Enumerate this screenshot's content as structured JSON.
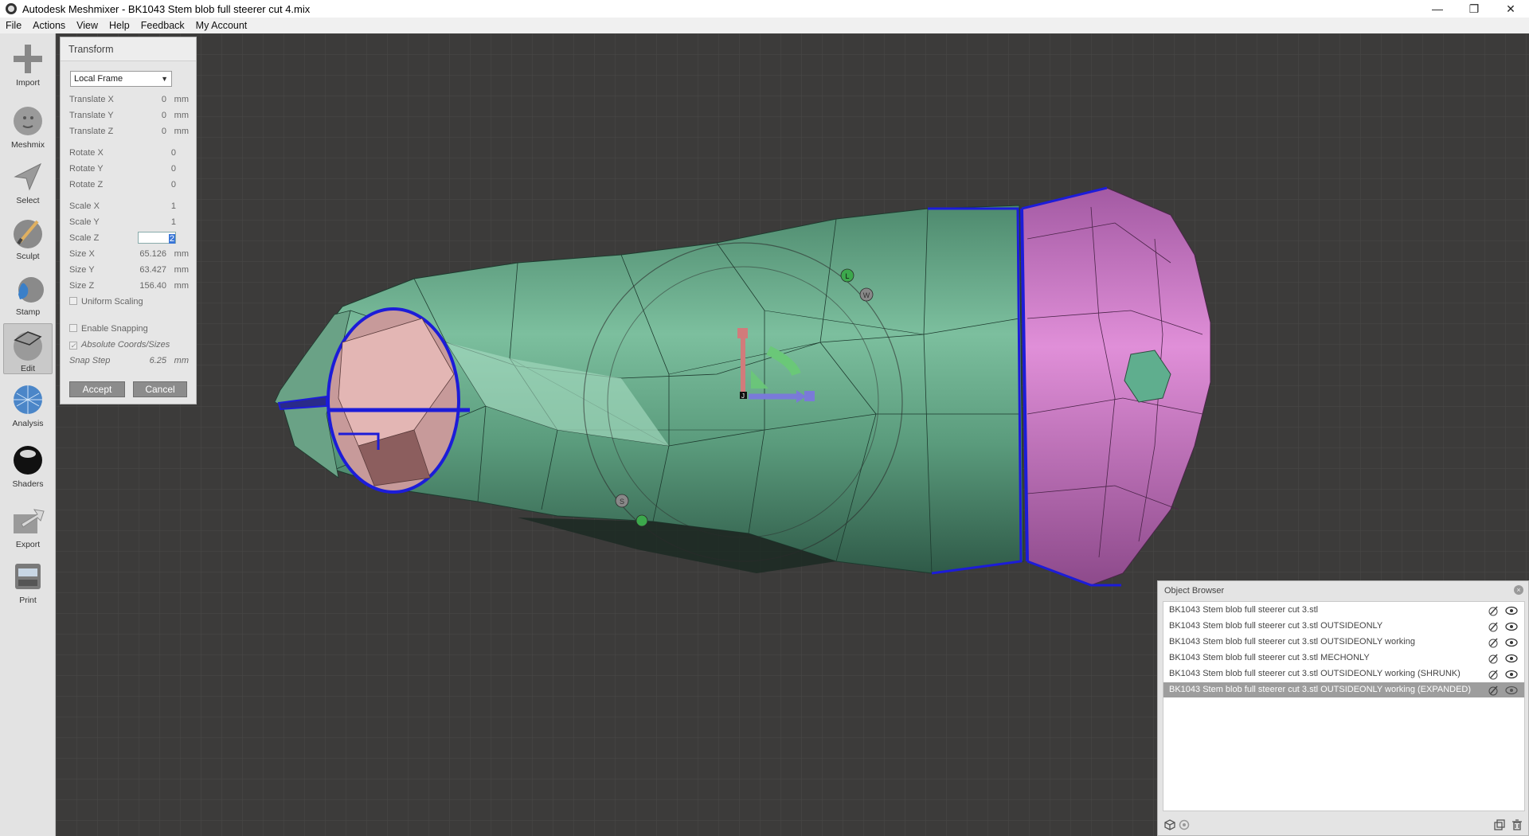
{
  "window": {
    "title": "Autodesk Meshmixer - BK1043 Stem blob full steerer cut 4.mix",
    "minimize": "—",
    "maximize": "❐",
    "close": "✕"
  },
  "menu": [
    "File",
    "Actions",
    "View",
    "Help",
    "Feedback",
    "My Account"
  ],
  "toolbar": [
    {
      "label": "Import",
      "icon": "plus-icon"
    },
    {
      "label": "Meshmix",
      "icon": "meshmix-bunny-icon"
    },
    {
      "label": "Select",
      "icon": "select-arrow-icon"
    },
    {
      "label": "Sculpt",
      "icon": "sculpt-brush-icon"
    },
    {
      "label": "Stamp",
      "icon": "stamp-icon"
    },
    {
      "label": "Edit",
      "icon": "edit-icon",
      "active": true
    },
    {
      "label": "Analysis",
      "icon": "analysis-icon"
    },
    {
      "label": "Shaders",
      "icon": "shaders-sphere-icon"
    },
    {
      "label": "Export",
      "icon": "export-icon"
    },
    {
      "label": "Print",
      "icon": "print-icon"
    }
  ],
  "transform": {
    "title": "Transform",
    "frame": "Local Frame",
    "translate": [
      {
        "label": "Translate X",
        "value": "0",
        "unit": "mm"
      },
      {
        "label": "Translate Y",
        "value": "0",
        "unit": "mm"
      },
      {
        "label": "Translate Z",
        "value": "0",
        "unit": "mm"
      }
    ],
    "rotate": [
      {
        "label": "Rotate X",
        "value": "0"
      },
      {
        "label": "Rotate Y",
        "value": "0"
      },
      {
        "label": "Rotate Z",
        "value": "0"
      }
    ],
    "scale": [
      {
        "label": "Scale X",
        "value": "1"
      },
      {
        "label": "Scale Y",
        "value": "1"
      },
      {
        "label": "Scale Z",
        "value": "2"
      }
    ],
    "size": [
      {
        "label": "Size X",
        "value": "65.126",
        "unit": "mm"
      },
      {
        "label": "Size Y",
        "value": "63.427",
        "unit": "mm"
      },
      {
        "label": "Size Z",
        "value": "156.40",
        "unit": "mm"
      }
    ],
    "uniform_scaling": "Uniform Scaling",
    "enable_snapping": "Enable Snapping",
    "absolute_coords": "Absolute Coords/Sizes",
    "snap_step_label": "Snap Step",
    "snap_step_value": "6.25",
    "snap_step_unit": "mm",
    "accept": "Accept",
    "cancel": "Cancel"
  },
  "object_browser": {
    "title": "Object Browser",
    "items": [
      "BK1043 Stem blob full steerer cut 3.stl",
      "BK1043 Stem blob full steerer cut 3.stl OUTSIDEONLY",
      "BK1043 Stem blob full steerer cut 3.stl OUTSIDEONLY working",
      "BK1043 Stem blob full steerer cut 3.stl MECHONLY",
      "BK1043 Stem blob full steerer cut 3.stl OUTSIDEONLY working (SHRUNK)",
      "BK1043 Stem blob full steerer cut 3.stl OUTSIDEONLY working (EXPANDED)"
    ],
    "selected_index": 5
  },
  "gizmo": {
    "label_w": "W",
    "label_s": "S",
    "label_l": "L",
    "label_j": "J"
  },
  "colors": {
    "mesh_green": "#5f9a7e",
    "mesh_pink": "#c478c0",
    "outline_blue": "#1c1cd8",
    "background": "#3c3b3a"
  }
}
